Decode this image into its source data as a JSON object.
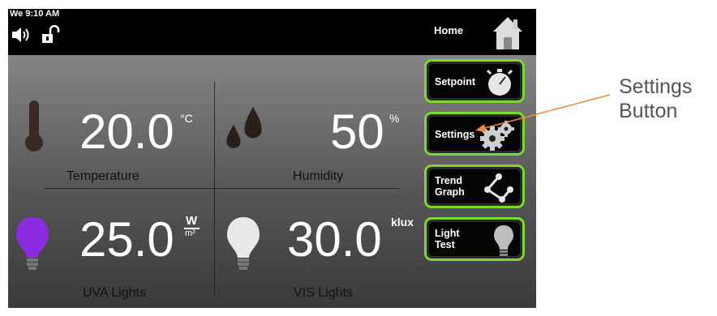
{
  "status_bar": {
    "day_time": "We 9:10 AM"
  },
  "home": {
    "label": "Home"
  },
  "readings": {
    "temperature": {
      "value": "20.0",
      "unit": "°C",
      "label": "Temperature"
    },
    "humidity": {
      "value": "50",
      "unit": "%",
      "label": "Humidity"
    },
    "uva": {
      "value": "25.0",
      "unit_num": "W",
      "unit_den": "m²",
      "label": "UVA Lights"
    },
    "vis": {
      "value": "30.0",
      "unit": "klux",
      "label": "VIS Lights"
    }
  },
  "buttons": {
    "setpoint": "Setpoint",
    "settings": "Settings",
    "trend_line1": "Trend",
    "trend_line2": "Graph",
    "light_line1": "Light",
    "light_line2": "Test"
  },
  "annotation": {
    "line1": "Settings",
    "line2": "Button"
  },
  "colors": {
    "accent_border": "#7fd62e",
    "uva_bulb": "#8b2be2",
    "annotation_arrow": "#f0883a"
  },
  "icons": [
    "speaker-icon",
    "unlock-icon",
    "house-icon",
    "thermometer-icon",
    "droplets-icon",
    "uva-bulb-icon",
    "vis-bulb-icon",
    "stopwatch-icon",
    "gears-icon",
    "trend-graph-icon",
    "light-bulb-icon"
  ]
}
